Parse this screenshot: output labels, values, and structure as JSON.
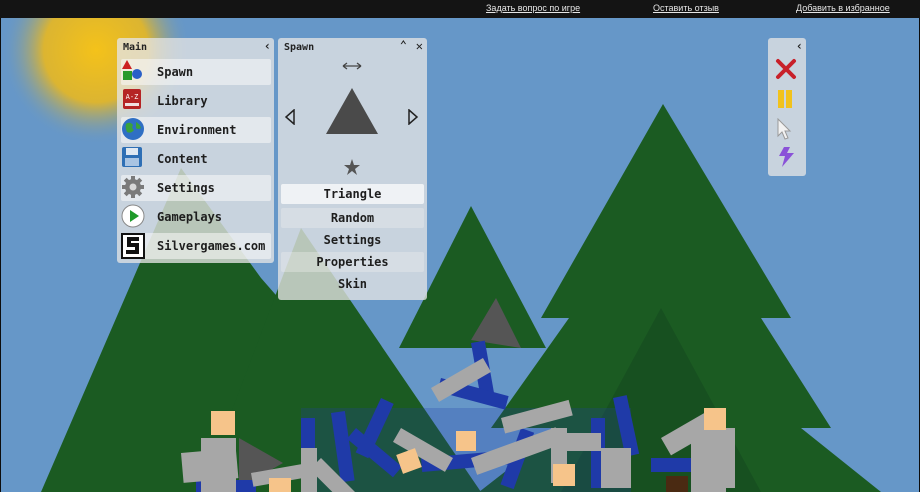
{
  "topbar": {
    "ask_question": "Задать вопрос по игре",
    "leave_review": "Оставить отзыв",
    "add_favorites": "Добавить в избранное"
  },
  "main_panel": {
    "title": "Main",
    "items": [
      {
        "label": "Spawn",
        "icon": "shapes-icon"
      },
      {
        "label": "Library",
        "icon": "book-icon"
      },
      {
        "label": "Environment",
        "icon": "globe-icon"
      },
      {
        "label": "Content",
        "icon": "save-icon"
      },
      {
        "label": "Settings",
        "icon": "gear-icon"
      },
      {
        "label": "Gameplays",
        "icon": "play-icon"
      },
      {
        "label": "Silvergames.com",
        "icon": "silvergames-logo-icon"
      }
    ],
    "book_icon_text": "A-Z"
  },
  "spawn_panel": {
    "title": "Spawn",
    "preview_shape": "Triangle",
    "buttons": [
      "Triangle",
      "Random",
      "Settings",
      "Properties",
      "Skin"
    ]
  },
  "tool_panel": {
    "tools": [
      "delete-x-icon",
      "pause-icon",
      "cursor-icon",
      "lightning-icon"
    ]
  },
  "colors": {
    "sky": "#6697c8",
    "tree": "#1b5b22",
    "sun": "#e8b81c",
    "ragdoll_blue": "#1f3aa8",
    "ragdoll_gray": "#a7a7a7",
    "skin": "#f6c48a"
  }
}
